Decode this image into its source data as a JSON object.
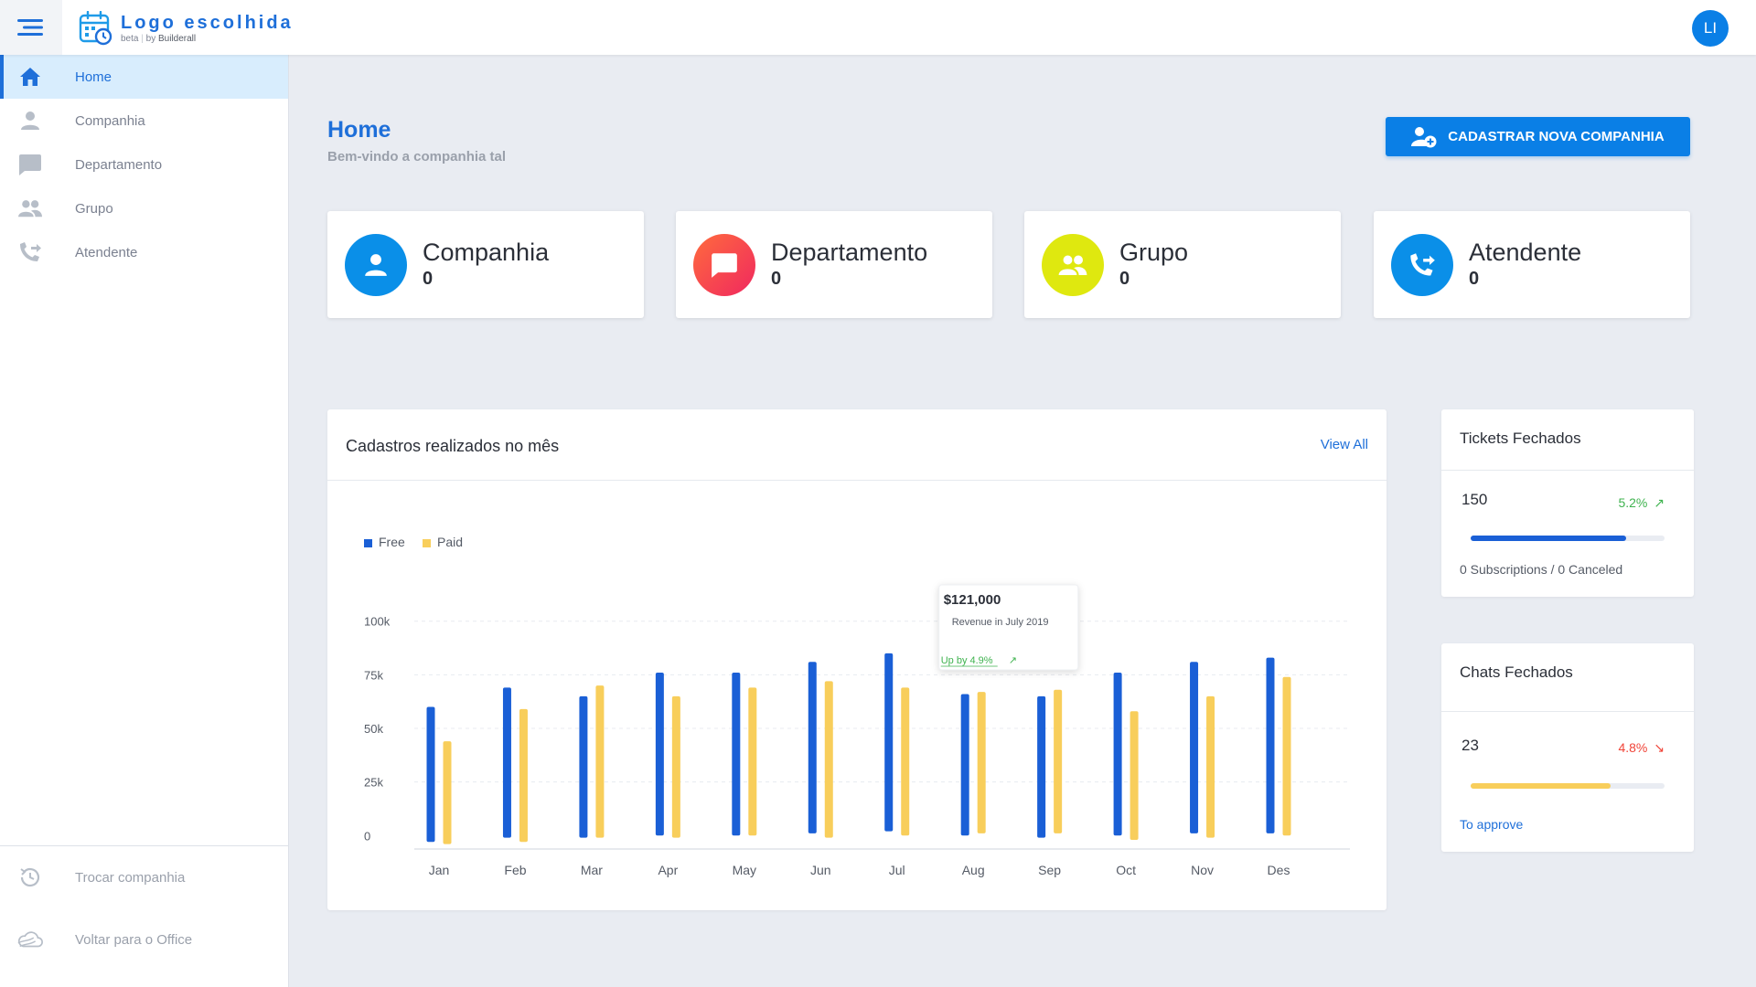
{
  "app": {
    "logo_title": "Logo escolhida",
    "logo_beta": "beta",
    "logo_by": "by",
    "logo_brand": "Builderall"
  },
  "user": {
    "initials": "LI"
  },
  "sidebar": {
    "items": [
      {
        "label": "Home",
        "icon": "home-icon",
        "active": true
      },
      {
        "label": "Companhia",
        "icon": "person-icon"
      },
      {
        "label": "Departamento",
        "icon": "chat-bubble-icon"
      },
      {
        "label": "Grupo",
        "icon": "people-icon"
      },
      {
        "label": "Atendente",
        "icon": "phone-forward-icon"
      }
    ],
    "bottom": [
      {
        "label": "Trocar companhia",
        "icon": "history-icon"
      },
      {
        "label": "Voltar para o Office",
        "icon": "cloud-icon"
      }
    ]
  },
  "header": {
    "title": "Home",
    "subtitle": "Bem-vindo a companhia tal",
    "button_label": "CADASTRAR NOVA COMPANHIA"
  },
  "stats": [
    {
      "label": "Companhia",
      "value": "0",
      "icon": "person-icon",
      "color": "#0a8fe8"
    },
    {
      "label": "Departamento",
      "value": "0",
      "icon": "chat-bubble-icon",
      "color": "#f03a5f"
    },
    {
      "label": "Grupo",
      "value": "0",
      "icon": "people-icon",
      "color": "#dfe80f"
    },
    {
      "label": "Atendente",
      "value": "0",
      "icon": "phone-forward-icon",
      "color": "#0a8fe8"
    }
  ],
  "chart_card": {
    "title": "Cadastros realizados no mês",
    "view_all": "View All"
  },
  "chart_data": {
    "type": "bar",
    "categories": [
      "Jan",
      "Feb",
      "Mar",
      "Apr",
      "May",
      "Jun",
      "Jul",
      "Aug",
      "Sep",
      "Oct",
      "Nov",
      "Des"
    ],
    "series": [
      {
        "name": "Free",
        "color": "#1a5fd6",
        "values": [
          [
            -3,
            60
          ],
          [
            -1,
            69
          ],
          [
            -1,
            65
          ],
          [
            0,
            76
          ],
          [
            0,
            76
          ],
          [
            1,
            81
          ],
          [
            2,
            85
          ],
          [
            0,
            66
          ],
          [
            -1,
            65
          ],
          [
            0,
            76
          ],
          [
            1,
            81
          ],
          [
            1,
            83
          ]
        ]
      },
      {
        "name": "Paid",
        "color": "#f8ce5b",
        "values": [
          [
            -4,
            44
          ],
          [
            -3,
            59
          ],
          [
            -1,
            70
          ],
          [
            -1,
            65
          ],
          [
            0,
            69
          ],
          [
            -1,
            72
          ],
          [
            0,
            69
          ],
          [
            1,
            67
          ],
          [
            1,
            68
          ],
          [
            -2,
            58
          ],
          [
            -1,
            65
          ],
          [
            0,
            74
          ]
        ]
      }
    ],
    "yticks": [
      0,
      25,
      50,
      75,
      100
    ],
    "ytick_labels": [
      "0",
      "25k",
      "50k",
      "75k",
      "100k"
    ],
    "ylim": [
      -5,
      105
    ],
    "grid": true,
    "legend": "top-left",
    "tooltip": {
      "category": "Jul",
      "value": "$121,000",
      "caption": "Revenue in July 2019",
      "change": "Up by 4.9%"
    }
  },
  "tickets": {
    "title": "Tickets Fechados",
    "value": "150",
    "change": "5.2%",
    "change_dir": "up",
    "progress": 0.8,
    "progress_color": "#1a5fd6",
    "footer": "0 Subscriptions / 0 Canceled"
  },
  "chats": {
    "title": "Chats Fechados",
    "value": "23",
    "change": "4.8%",
    "change_dir": "down",
    "progress": 0.72,
    "progress_color": "#f8ce5b",
    "footer": "To approve"
  }
}
